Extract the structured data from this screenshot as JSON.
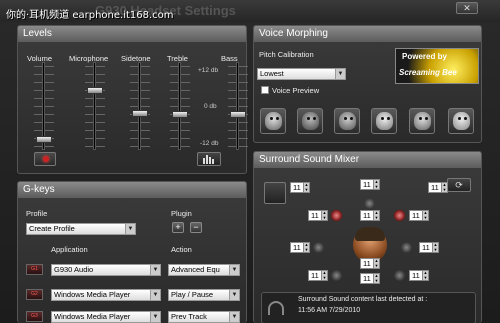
{
  "window": {
    "watermark": "你的·耳机频道 earphone.it168.com",
    "title": "G930 Headset Settings",
    "close_glyph": "✕"
  },
  "levels": {
    "title": "Levels",
    "labels": {
      "volume": "Volume",
      "microphone": "Microphone",
      "sidetone": "Sidetone",
      "treble": "Treble",
      "bass": "Bass"
    },
    "scale": {
      "top": "+12 db",
      "mid": "0 db",
      "bottom": "-12 db"
    },
    "slider_levels": {
      "volume": 0.09,
      "microphone": 0.69,
      "sidetone": 0.41,
      "treble": 0.4,
      "bass": 0.4
    }
  },
  "voice_morphing": {
    "title": "Voice Morphing",
    "pitch_label": "Pitch Calibration",
    "pitch_value": "Lowest",
    "preview_label": "Voice Preview",
    "logo_line1": "Powered by",
    "logo_line2": "Screaming Bee",
    "voices": [
      "robot-voice",
      "orc-voice",
      "dwarf-voice",
      "alien-voice",
      "elf-voice",
      "chipmunk-voice"
    ]
  },
  "surround": {
    "title": "Surround Sound Mixer",
    "values": [
      "11",
      "11",
      "11",
      "11",
      "11",
      "11",
      "11",
      "11",
      "11",
      "11",
      "11",
      "11"
    ],
    "info_line1": "Surround Sound content last detected at :",
    "info_line2": "11:56 AM 7/29/2010"
  },
  "gkeys": {
    "title": "G-keys",
    "profile_label": "Profile",
    "profile_value": "Create Profile",
    "plugin_label": "Plugin",
    "plus_glyph": "+",
    "minus_glyph": "−",
    "app_header": "Application",
    "action_header": "Action",
    "rows": [
      {
        "key": "G1",
        "app": "G930 Audio",
        "action": "Advanced Equ"
      },
      {
        "key": "G2",
        "app": "Windows Media Player",
        "action": "Play / Pause"
      },
      {
        "key": "G3",
        "app": "Windows Media Player",
        "action": "Prev Track"
      }
    ]
  },
  "colors": {
    "panel_header": "#6f6f6f",
    "accent_red": "#cc2222",
    "logo_gold": "#e8c400"
  },
  "icons": {
    "mute": "mute-icon",
    "equalizer": "equalizer-icon",
    "refresh": "refresh-icon",
    "headphones": "headphones-icon"
  }
}
